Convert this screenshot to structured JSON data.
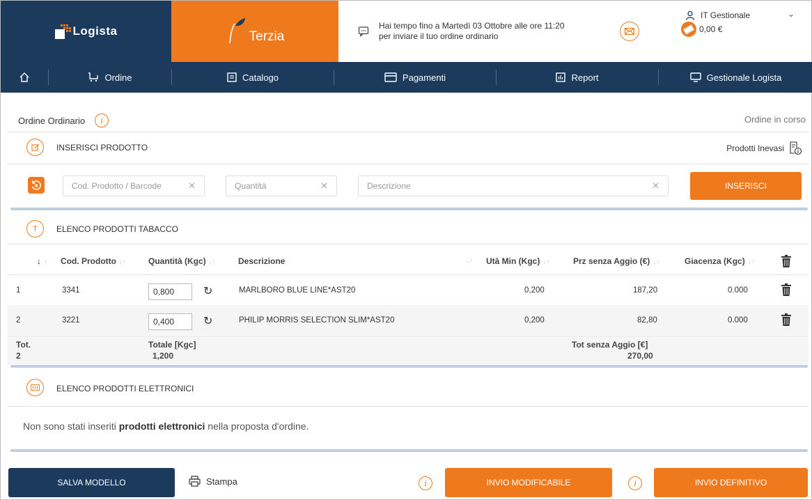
{
  "brand": {
    "logista": "Logista",
    "terzia": "Terzia"
  },
  "colors": {
    "navy": "#1b3a5c",
    "orange": "#ee7a1d"
  },
  "message": {
    "line1": "Hai tempo fino a Martedì 03 Ottobre alle ore 11:20",
    "line2": "per inviare il tuo ordine ordinario"
  },
  "user": {
    "name": "IT Gestionale",
    "balance": "0,00 €"
  },
  "nav": {
    "ordine": "Ordine",
    "catalogo": "Catalogo",
    "pagamenti": "Pagamenti",
    "report": "Report",
    "gestionale": "Gestionale Logista"
  },
  "order": {
    "title": "Ordine Ordinario",
    "status": "Ordine in corso"
  },
  "insert": {
    "title": "INSERISCI PRODOTTO",
    "inevasi": "Prodotti Inevasi",
    "code_placeholder": "Cod. Prodotto / Barcode",
    "qty_placeholder": "Quantità",
    "desc_placeholder": "Descrizione",
    "button": "INSERISCI"
  },
  "tabacco": {
    "title": "ELENCO PRODOTTI TABACCO",
    "badge": "T",
    "headers": {
      "code": "Cod. Prodotto",
      "qty": "Quantità (Kgc)",
      "desc": "Descrizione",
      "umin": "Utà Min (Kgc)",
      "price": "Prz senza Aggio (€)",
      "stock": "Giacenza (Kgc)"
    },
    "rows": [
      {
        "n": "1",
        "code": "3341",
        "qty": "0,800",
        "desc": "MARLBORO BLUE LINE*AST20",
        "umin": "0,200",
        "price": "187,20",
        "stock": "0.000"
      },
      {
        "n": "2",
        "code": "3221",
        "qty": "0,400",
        "desc": "PHILIP MORRIS SELECTION SLIM*AST20",
        "umin": "0,200",
        "price": "82,80",
        "stock": "0.000"
      }
    ],
    "totals": {
      "tot_label": "Tot.",
      "tot_count": "2",
      "kgc_label": "Totale [Kgc]",
      "kgc_value": "1,200",
      "aggio_label": "Tot senza Aggio [€]",
      "aggio_value": "270,00"
    }
  },
  "elettronici": {
    "title": "ELENCO PRODOTTI ELETTRONICI",
    "empty_prefix": "Non sono stati inseriti ",
    "empty_bold": "prodotti elettronici",
    "empty_suffix": " nella proposta d'ordine."
  },
  "footer": {
    "salva": "SALVA MODELLO",
    "stampa": "Stampa",
    "modificabile": "INVIO MODIFICABILE",
    "definitivo": "INVIO DEFINITIVO"
  }
}
